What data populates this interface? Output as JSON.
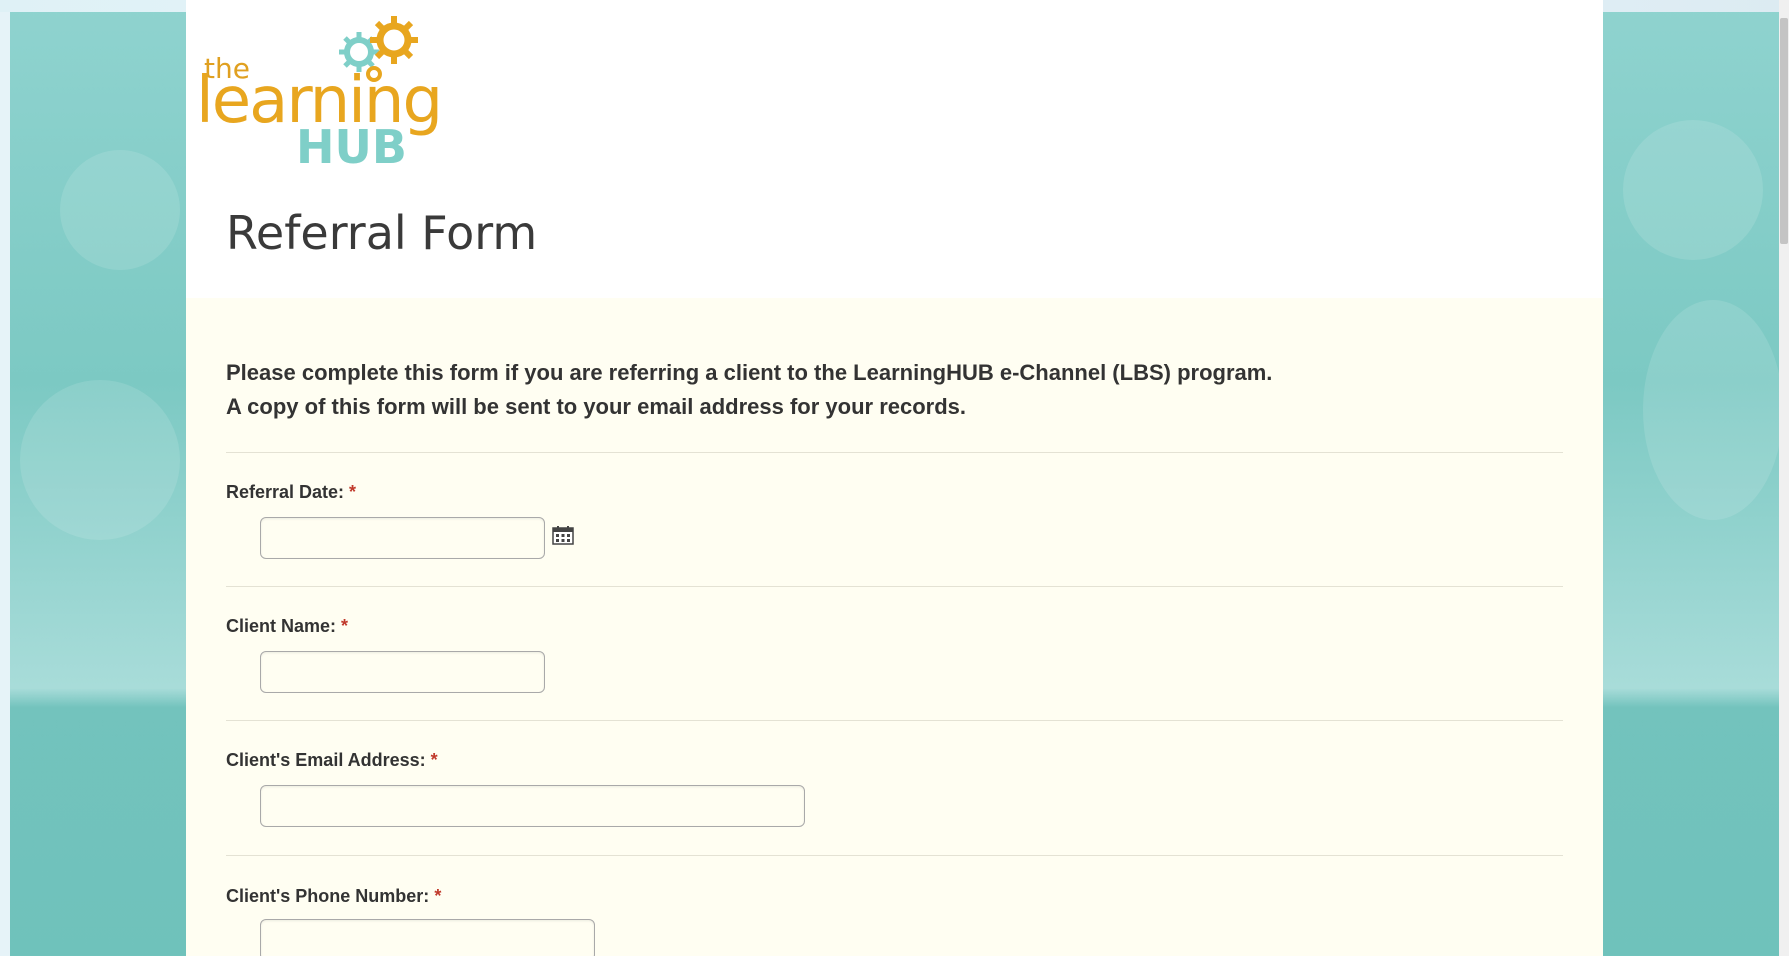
{
  "logo": {
    "small_text": "the",
    "main_text": "learning",
    "hub_text": "HUB"
  },
  "form": {
    "title": "Referral Form",
    "intro_line1": "Please complete this form if you are referring a client to the LearningHUB e-Channel (LBS) program.",
    "intro_line2": "A copy of this form will be sent to your email address for your records.",
    "required_marker": "*",
    "fields": [
      {
        "label": "Referral Date:",
        "value": "",
        "has_calendar": true
      },
      {
        "label": "Client Name:",
        "value": ""
      },
      {
        "label": "Client's Email Address:",
        "value": ""
      },
      {
        "label": "Client's Phone Number:",
        "value": ""
      }
    ]
  },
  "icons": {
    "calendar": "calendar-icon",
    "gears": "gears-icon"
  },
  "colors": {
    "teal_background": "#7cc9c3",
    "form_background": "#fffef2",
    "logo_orange": "#e8a61f",
    "logo_teal": "#7fcfc8",
    "required_red": "#c0392b"
  }
}
